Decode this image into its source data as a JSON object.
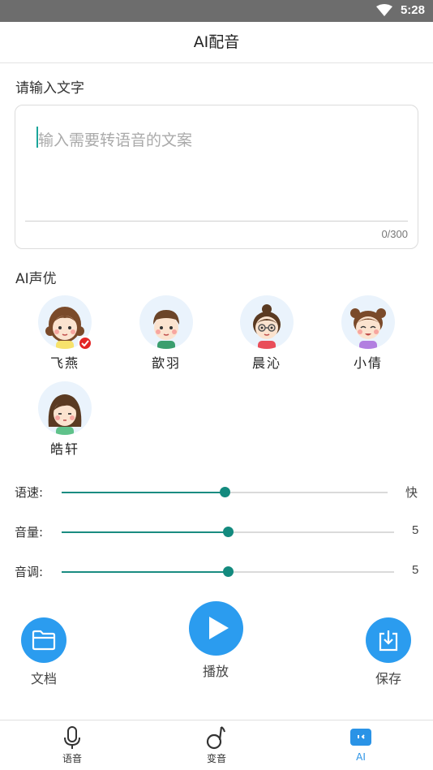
{
  "status_bar": {
    "time": "5:28"
  },
  "app_bar": {
    "title": "AI配音"
  },
  "input_section": {
    "label": "请输入文字",
    "placeholder": "输入需要转语音的文案",
    "counter": "0/300"
  },
  "voice_section": {
    "label": "AI声优",
    "voices": [
      {
        "name": "飞燕",
        "selected": true
      },
      {
        "name": "歆羽",
        "selected": false
      },
      {
        "name": "晨沁",
        "selected": false
      },
      {
        "name": "小倩",
        "selected": false
      },
      {
        "name": "皓轩",
        "selected": false
      }
    ]
  },
  "sliders": {
    "speed": {
      "label": "语速:",
      "value_text": "快",
      "level_fraction": 0.5
    },
    "volume": {
      "label": "音量:",
      "value_text": "5",
      "level_fraction": 0.5
    },
    "pitch": {
      "label": "音调:",
      "value_text": "5",
      "level_fraction": 0.5
    }
  },
  "actions": {
    "document": {
      "label": "文档",
      "icon": "folder-icon"
    },
    "play": {
      "label": "播放",
      "icon": "play-icon"
    },
    "save": {
      "label": "保存",
      "icon": "download-icon"
    }
  },
  "bottom_nav": {
    "items": [
      {
        "label": "语音",
        "icon": "microphone-icon",
        "active": false
      },
      {
        "label": "变音",
        "icon": "music-note-icon",
        "active": false
      },
      {
        "label": "AI",
        "icon": "ai-icon",
        "active": true
      }
    ]
  },
  "colors": {
    "accent": "#2b9cef",
    "slider": "#138a7e",
    "selected_badge": "#e32626",
    "nav_active": "#2a93e6"
  }
}
